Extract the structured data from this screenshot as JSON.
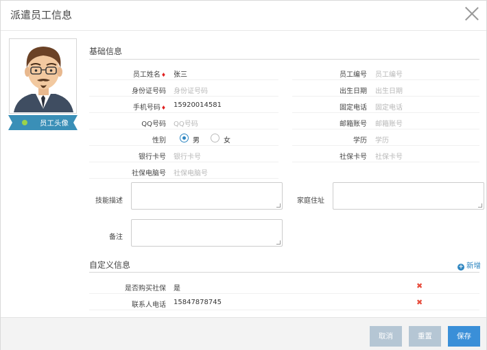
{
  "dialog": {
    "title": "派遣员工信息"
  },
  "avatar": {
    "label": "员工头像"
  },
  "basic": {
    "title": "基础信息",
    "name_label": "员工姓名",
    "name_value": "张三",
    "empno_label": "员工编号",
    "empno_placeholder": "员工编号",
    "idcard_label": "身份证号码",
    "idcard_placeholder": "身份证号码",
    "birth_label": "出生日期",
    "birth_placeholder": "出生日期",
    "phone_label": "手机号码",
    "phone_value": "15920014581",
    "tel_label": "固定电话",
    "tel_placeholder": "固定电话",
    "qq_label": "QQ号码",
    "qq_placeholder": "QQ号码",
    "mail_label": "邮箱账号",
    "mail_placeholder": "邮箱账号",
    "gender_label": "性别",
    "gender_male": "男",
    "gender_female": "女",
    "edu_label": "学历",
    "edu_placeholder": "学历",
    "bank_label": "银行卡号",
    "bank_placeholder": "银行卡号",
    "sscard_label": "社保卡号",
    "sscard_placeholder": "社保卡号",
    "sspc_label": "社保电脑号",
    "sspc_placeholder": "社保电脑号",
    "skill_label": "技能描述",
    "address_label": "家庭住址",
    "remark_label": "备注"
  },
  "custom": {
    "title": "自定义信息",
    "add_label": "新增",
    "rows": [
      {
        "label": "是否购买社保",
        "value": "是"
      },
      {
        "label": "联系人电话",
        "value": "15847878745"
      }
    ]
  },
  "footer": {
    "cancel": "取消",
    "reset": "重置",
    "save": "保存"
  },
  "colors": {
    "primary": "#3a8fd8",
    "disabled": "#b5c6d4",
    "required": "#e02020",
    "delete": "#e74c3c"
  }
}
